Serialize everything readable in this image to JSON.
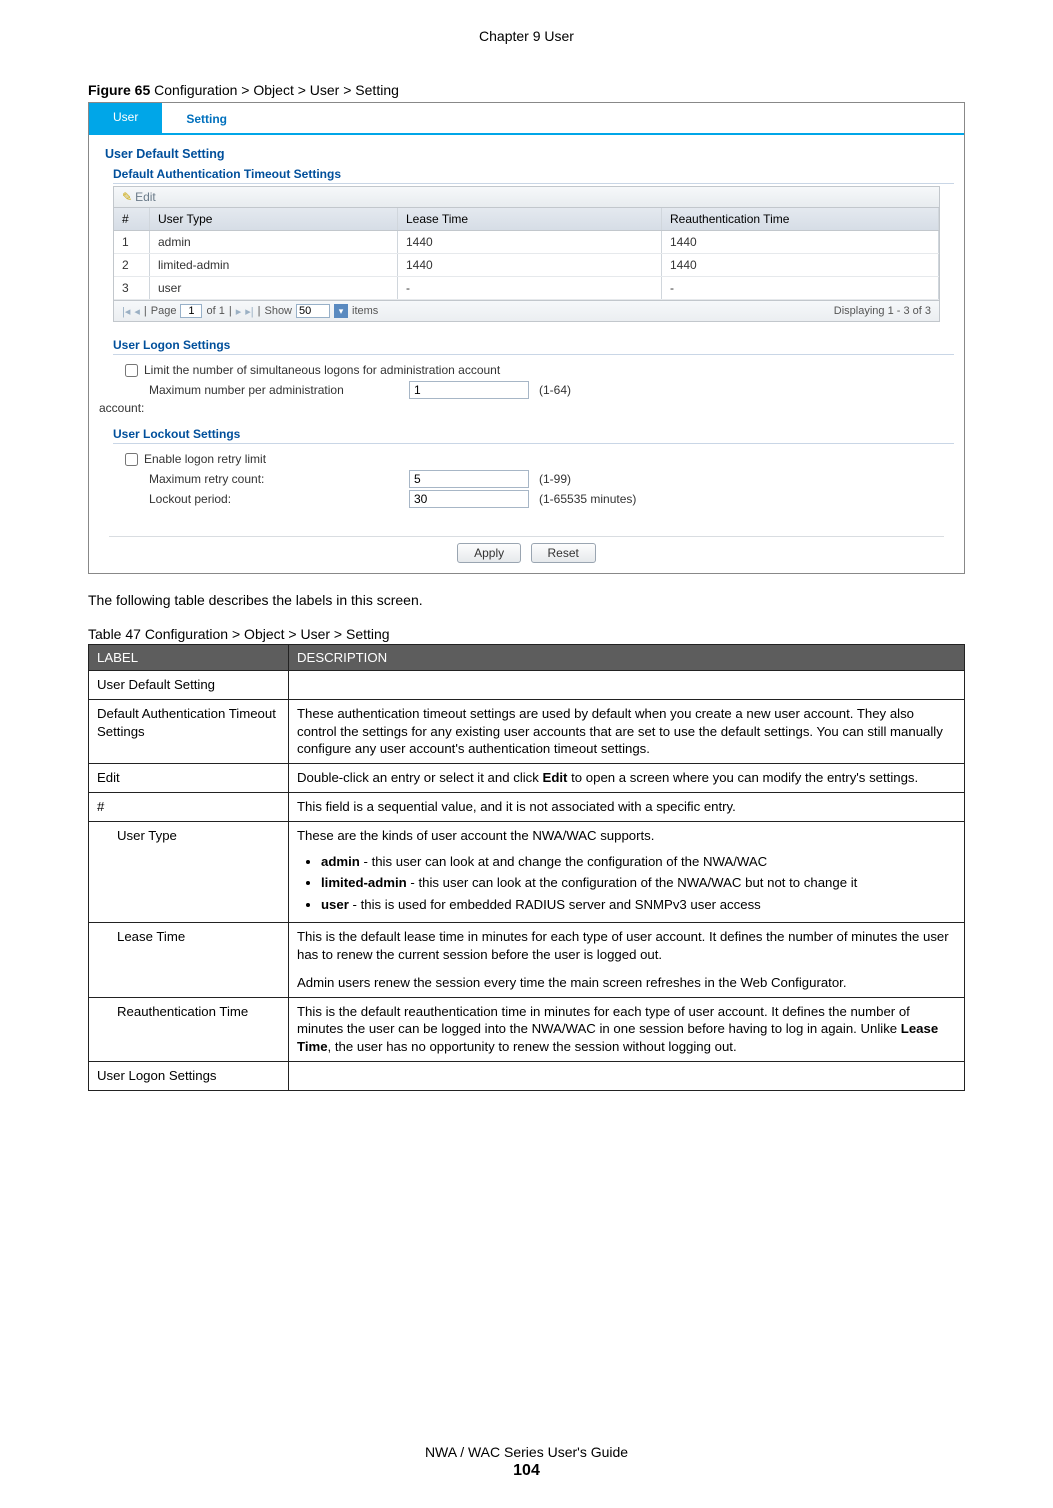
{
  "header": {
    "chapter": "Chapter 9 User"
  },
  "figure": {
    "label_prefix": "Figure 65",
    "label_rest": "   Configuration > Object > User > Setting"
  },
  "screenshot": {
    "tabs": {
      "user": "User",
      "setting": "Setting"
    },
    "sections": {
      "default_title": "User Default Setting",
      "auth_title": "Default Authentication Timeout Settings",
      "toolbar_edit": "Edit",
      "columns": {
        "idx": "#",
        "user_type": "User Type",
        "lease_time": "Lease Time",
        "reauth_time": "Reauthentication Time"
      },
      "rows": [
        {
          "idx": "1",
          "user_type": "admin",
          "lease_time": "1440",
          "reauth_time": "1440"
        },
        {
          "idx": "2",
          "user_type": "limited-admin",
          "lease_time": "1440",
          "reauth_time": "1440"
        },
        {
          "idx": "3",
          "user_type": "user",
          "lease_time": "-",
          "reauth_time": "-"
        }
      ],
      "pager": {
        "page_label_pre": "Page",
        "page_value": "1",
        "page_label_post": "of 1",
        "show_label": "Show",
        "show_value": "50",
        "items_label": "items",
        "displaying": "Displaying 1 - 3 of 3"
      },
      "logon_title": "User Logon Settings",
      "logon_limit_label": "Limit the number of simultaneous logons for administration account",
      "logon_max_label": "Maximum number per administration",
      "logon_account_suffix": "account:",
      "logon_max_value": "1",
      "logon_range": "(1-64)",
      "lockout_title": "User Lockout Settings",
      "lockout_enable_label": "Enable logon retry limit",
      "lockout_retry_label": "Maximum retry count:",
      "lockout_retry_value": "5",
      "lockout_retry_range": "(1-99)",
      "lockout_period_label": "Lockout period:",
      "lockout_period_value": "30",
      "lockout_period_range": "(1-65535 minutes)",
      "apply": "Apply",
      "reset": "Reset"
    }
  },
  "body_text": "The following table describes the labels in this screen.",
  "doc_table": {
    "caption": "Table 47   Configuration > Object > User > Setting",
    "header_label": "LABEL",
    "header_desc": "DESCRIPTION",
    "rows": {
      "r1_label": "User Default Setting",
      "r1_desc": "",
      "r2_label": "Default Authentication Timeout Settings",
      "r2_desc": "These authentication timeout settings are used by default when you create a new user account. They also control the settings for any existing user accounts that are set to use the default settings. You can still manually configure any user account's authentication timeout settings.",
      "r3_label": "Edit",
      "r3_desc_pre": "Double-click an entry or select it and click ",
      "r3_desc_bold": "Edit",
      "r3_desc_post": " to open a screen where you can modify the entry's settings.",
      "r4_label": "#",
      "r4_desc": "This field is a sequential value, and it is not associated with a specific entry.",
      "r5_label": "User Type",
      "r5_intro": "These are the kinds of user account the NWA/WAC supports.",
      "r5_b1_bold": "admin",
      "r5_b1_rest": " - this user can look at and change the configuration of the NWA/WAC",
      "r5_b2_bold": "limited-admin",
      "r5_b2_rest": " - this user can look at the configuration of the NWA/WAC but not to change it",
      "r5_b3_bold": "user",
      "r5_b3_rest": " - this is used for embedded RADIUS server and SNMPv3 user access",
      "r6_label": "Lease Time",
      "r6_desc_p1": "This is the default lease time in minutes for each type of user account. It defines the number of minutes the user has to renew the current session before the user is logged out.",
      "r6_desc_p2": "Admin users renew the session every time the main screen refreshes in the Web Configurator.",
      "r7_label": "Reauthentication Time",
      "r7_desc_pre": "This is the default reauthentication time in minutes for each type of user account. It defines the number of minutes the user can be logged into the NWA/WAC in one session before having to log in again. Unlike ",
      "r7_desc_bold": "Lease Time",
      "r7_desc_post": ", the user has no opportunity to renew the session without logging out.",
      "r8_label": "User Logon Settings",
      "r8_desc": ""
    }
  },
  "footer": {
    "guide": "NWA / WAC Series User's Guide",
    "page": "104"
  }
}
